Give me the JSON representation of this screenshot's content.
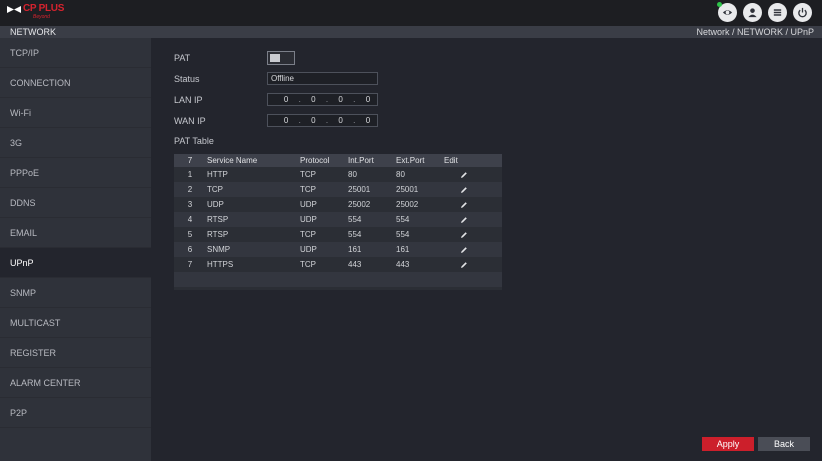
{
  "header": {
    "logo_brand": "CP PLUS",
    "logo_sub": "Beyond",
    "icons": [
      "eye-icon",
      "user-icon",
      "menu-icon",
      "power-icon"
    ]
  },
  "titlebar": {
    "title": "NETWORK",
    "breadcrumb": "Network  /  NETWORK  /  UPnP"
  },
  "sidebar": {
    "items": [
      {
        "label": "TCP/IP"
      },
      {
        "label": "CONNECTION"
      },
      {
        "label": "Wi-Fi"
      },
      {
        "label": "3G"
      },
      {
        "label": "PPPoE"
      },
      {
        "label": "DDNS"
      },
      {
        "label": "EMAIL"
      },
      {
        "label": "UPnP"
      },
      {
        "label": "SNMP"
      },
      {
        "label": "MULTICAST"
      },
      {
        "label": "REGISTER"
      },
      {
        "label": "ALARM CENTER"
      },
      {
        "label": "P2P"
      }
    ],
    "active_index": 7
  },
  "form": {
    "pat_label": "PAT",
    "pat_enabled": false,
    "status_label": "Status",
    "status_value": "Offline",
    "lan_ip_label": "LAN IP",
    "lan_ip": [
      "0",
      "0",
      "0",
      "0"
    ],
    "wan_ip_label": "WAN IP",
    "wan_ip": [
      "0",
      "0",
      "0",
      "0"
    ],
    "pat_table_label": "PAT Table"
  },
  "pat_table": {
    "headers": [
      "7",
      "Service Name",
      "Protocol",
      "Int.Port",
      "Ext.Port",
      "Edit"
    ],
    "rows": [
      {
        "no": "1",
        "service": "HTTP",
        "protocol": "TCP",
        "int_port": "80",
        "ext_port": "80"
      },
      {
        "no": "2",
        "service": "TCP",
        "protocol": "TCP",
        "int_port": "25001",
        "ext_port": "25001"
      },
      {
        "no": "3",
        "service": "UDP",
        "protocol": "UDP",
        "int_port": "25002",
        "ext_port": "25002"
      },
      {
        "no": "4",
        "service": "RTSP",
        "protocol": "UDP",
        "int_port": "554",
        "ext_port": "554"
      },
      {
        "no": "5",
        "service": "RTSP",
        "protocol": "TCP",
        "int_port": "554",
        "ext_port": "554"
      },
      {
        "no": "6",
        "service": "SNMP",
        "protocol": "UDP",
        "int_port": "161",
        "ext_port": "161"
      },
      {
        "no": "7",
        "service": "HTTPS",
        "protocol": "TCP",
        "int_port": "443",
        "ext_port": "443"
      }
    ]
  },
  "buttons": {
    "apply": "Apply",
    "back": "Back"
  },
  "colors": {
    "accent": "#cc1f2b",
    "background": "#23252d",
    "sidebar": "#2f323a"
  }
}
